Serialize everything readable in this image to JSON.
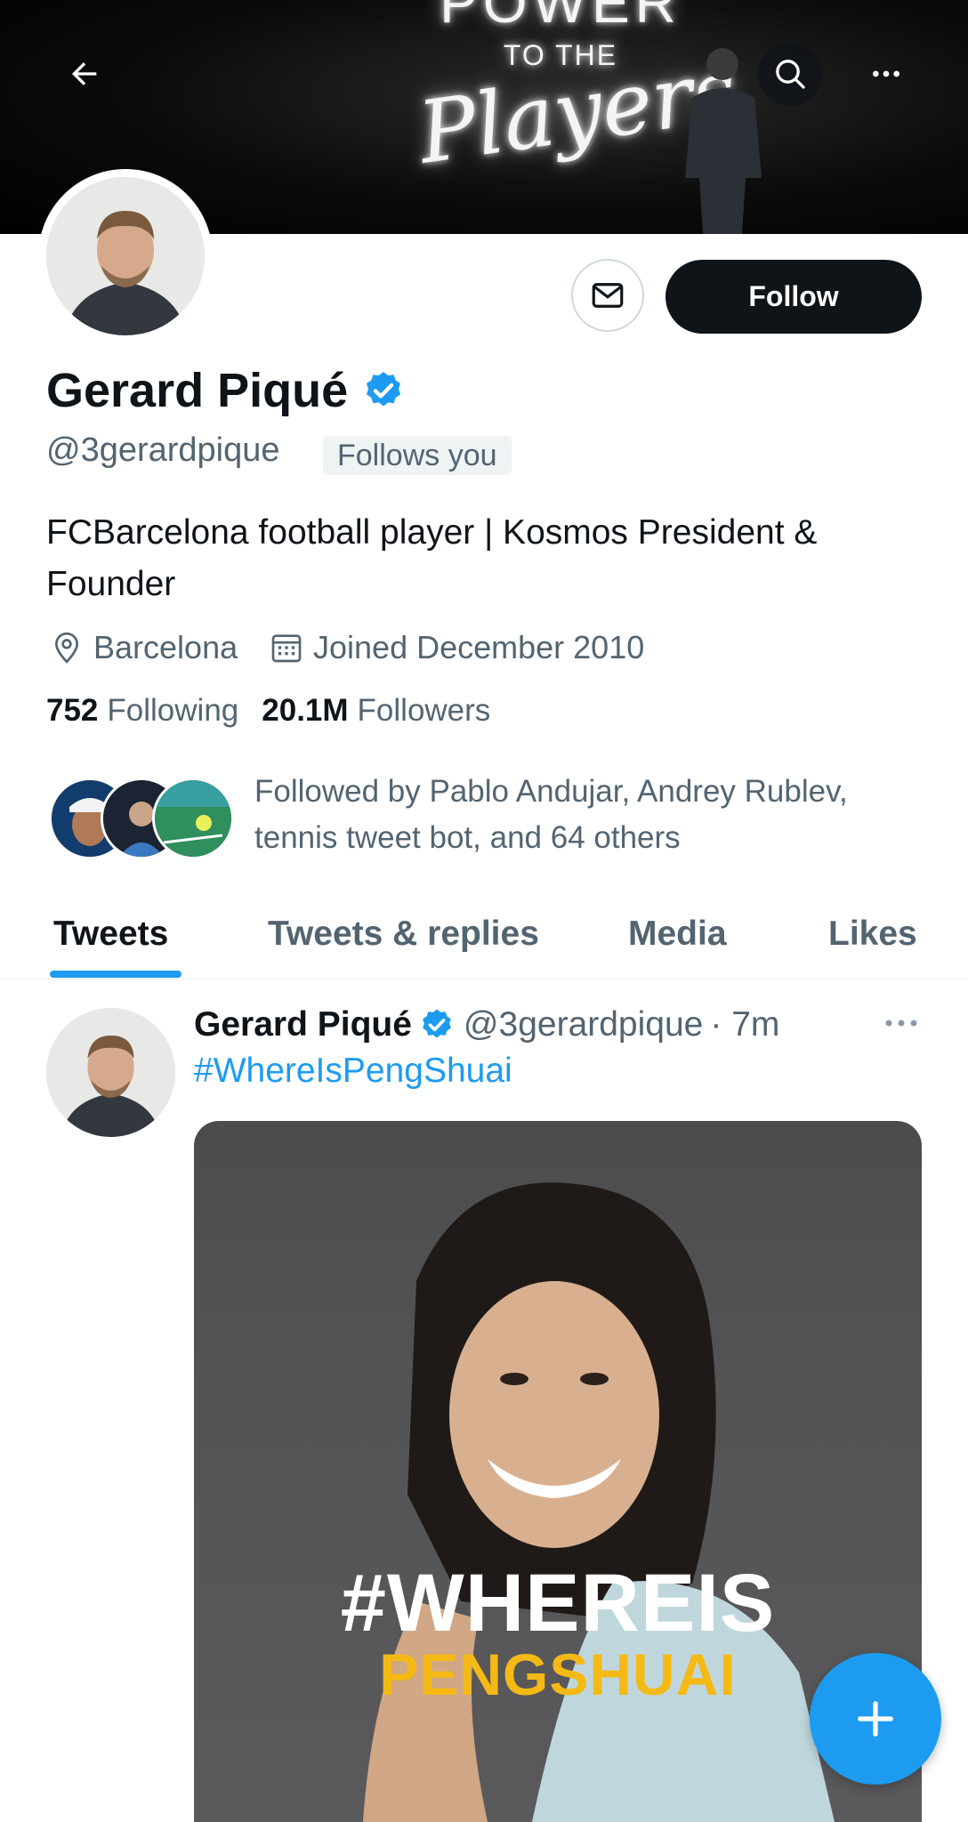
{
  "banner": {
    "neon_line_1": "POWER",
    "neon_line_2": "TO THE",
    "neon_line_3": "Players"
  },
  "header": {
    "back_icon": "arrow-left-icon",
    "search_icon": "search-icon",
    "more_icon": "more-horizontal-icon"
  },
  "profile": {
    "name": "Gerard Piqué",
    "handle": "@3gerardpique",
    "follows_you": "Follows you",
    "bio": "FCBarcelona football player | Kosmos President & Founder",
    "location": "Barcelona",
    "joined": "Joined December 2010",
    "following_count": "752",
    "following_label": "Following",
    "followers_count": "20.1M",
    "followers_label": "Followers",
    "followed_by": "Followed by Pablo Andujar, Andrey Rublev, tennis tweet bot, and 64 others"
  },
  "actions": {
    "follow_label": "Follow",
    "message_icon": "envelope-icon"
  },
  "tabs": [
    {
      "label": "Tweets",
      "active": true
    },
    {
      "label": "Tweets & replies",
      "active": false
    },
    {
      "label": "Media",
      "active": false
    },
    {
      "label": "Likes",
      "active": false
    }
  ],
  "tweet": {
    "name": "Gerard Piqué",
    "handle": "@3gerardpique",
    "time": "· 7m",
    "text": "#WhereIsPengShuai",
    "media_text_1": "#WHEREIS",
    "media_text_2": "PENGSHUAI"
  },
  "colors": {
    "accent": "#1d9bf0",
    "text_primary": "#0f1419",
    "text_secondary": "#536471",
    "media_yellow": "#f5b915"
  }
}
